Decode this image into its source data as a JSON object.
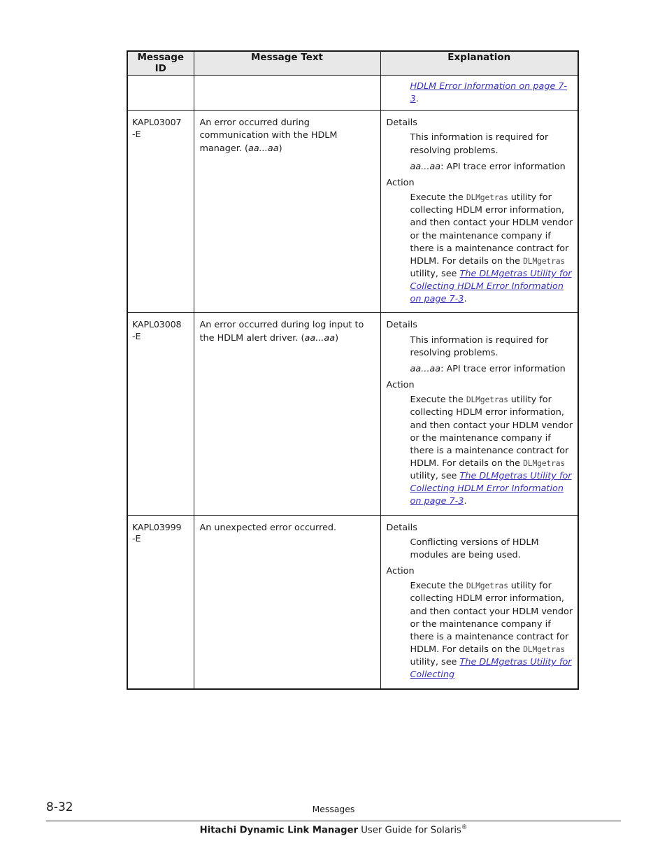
{
  "document": {
    "page_number": "8-32",
    "chapter_title": "Messages",
    "guide_title_bold": "Hitachi Dynamic Link Manager",
    "guide_title_rest": " User Guide for Solaris",
    "guide_title_sup": "®"
  },
  "table": {
    "headers": {
      "col1_line1": "Message",
      "col1_line2": "ID",
      "col2": "Message Text",
      "col3": "Explanation"
    },
    "rows": [
      {
        "continuation": true,
        "message_id": "",
        "message_text": "",
        "explanation_continued": {
          "link_text": "HDLM Error Information on page 7-3",
          "trailing": "."
        }
      },
      {
        "continuation": false,
        "message_id_line1": "KAPL03007",
        "message_id_line2": "-E",
        "message_text_pre": "An error occurred during communication with the HDLM manager. (",
        "message_text_italic": "aa...aa",
        "message_text_post": ")",
        "details_label": "Details",
        "details_para1": "This information is required for resolving problems.",
        "details_para2_italic": "aa...aa",
        "details_para2_rest": ": API trace error information",
        "action_label": "Action",
        "action_pre": "Execute the ",
        "action_mono1": "DLMgetras",
        "action_mid": " utility for collecting HDLM error information, and then contact your HDLM vendor or the maintenance company if there is a maintenance contract for HDLM. For details on the ",
        "action_mono2": "DLMgetras",
        "action_post": " utility, see ",
        "action_link": "The DLMgetras Utility for Collecting HDLM Error Information on page 7-3",
        "action_end": "."
      },
      {
        "continuation": false,
        "message_id_line1": "KAPL03008",
        "message_id_line2": "-E",
        "message_text_pre": "An error occurred during log input to the HDLM alert driver. (",
        "message_text_italic": "aa...aa",
        "message_text_post": ")",
        "details_label": "Details",
        "details_para1": "This information is required for resolving problems.",
        "details_para2_italic": "aa...aa",
        "details_para2_rest": ": API trace error information",
        "action_label": "Action",
        "action_pre": "Execute the ",
        "action_mono1": "DLMgetras",
        "action_mid": " utility for collecting HDLM error information, and then contact your HDLM vendor or the maintenance company if there is a maintenance contract for HDLM. For details on the ",
        "action_mono2": "DLMgetras",
        "action_post": " utility, see ",
        "action_link": "The DLMgetras Utility for Collecting HDLM Error Information on page 7-3",
        "action_end": "."
      },
      {
        "continuation": false,
        "message_id_line1": "KAPL03999",
        "message_id_line2": "-E",
        "message_text_pre": "An unexpected error occurred.",
        "message_text_italic": "",
        "message_text_post": "",
        "details_label": "Details",
        "details_para1": "Conflicting versions of HDLM modules are being used.",
        "details_para2_italic": "",
        "details_para2_rest": "",
        "action_label": "Action",
        "action_pre": "Execute the ",
        "action_mono1": "DLMgetras",
        "action_mid": " utility for collecting HDLM error information, and then contact your HDLM vendor or the maintenance company if there is a maintenance contract for HDLM. For details on the ",
        "action_mono2": "DLMgetras",
        "action_post": " utility, see ",
        "action_link": "The DLMgetras Utility for Collecting",
        "action_end": ""
      }
    ]
  },
  "colors": {
    "link": "#3a33b5",
    "header_bg": "#e8e8e8",
    "border": "#1a1a1a",
    "mono_text": "#4a4a4a"
  }
}
